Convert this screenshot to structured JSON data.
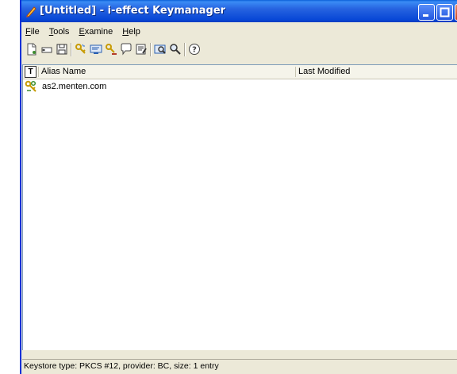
{
  "window": {
    "title": "[Untitled] - i-effect Keymanager"
  },
  "menu": [
    "File",
    "Tools",
    "Examine",
    "Help"
  ],
  "toolbar": {
    "icons": [
      "new-keystore-icon",
      "open-keystore-icon",
      "save-keystore-icon",
      "generate-keypair-icon",
      "import-certificate-icon",
      "import-keypair-icon",
      "certificate-request-icon",
      "properties-icon",
      "examine-keystore-icon",
      "search-icon",
      "help-icon"
    ]
  },
  "table": {
    "type_header": "T",
    "columns": [
      "Alias Name",
      "Last Modified"
    ],
    "rows": [
      {
        "alias": "as2.menten.com",
        "last_modified": ""
      }
    ]
  },
  "status": "Keystore type: PKCS #12, provider: BC, size: 1 entry"
}
